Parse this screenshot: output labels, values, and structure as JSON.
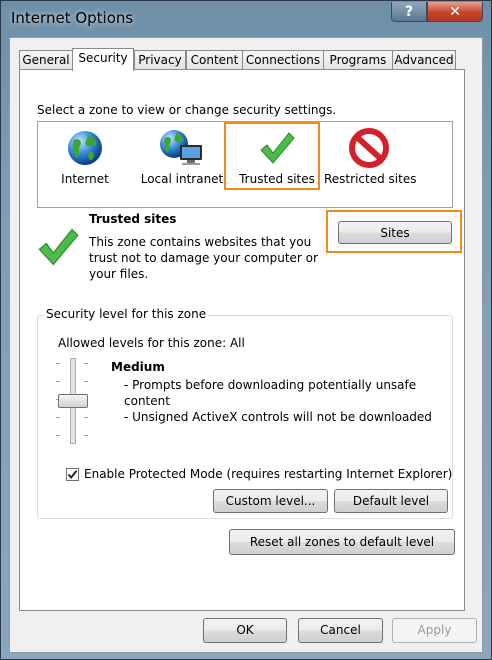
{
  "window": {
    "title": "Internet Options",
    "help_label": "?",
    "close_label": "✕"
  },
  "tabs": [
    "General",
    "Security",
    "Privacy",
    "Content",
    "Connections",
    "Programs",
    "Advanced"
  ],
  "active_tab": "Security",
  "zone_prompt": "Select a zone to view or change security settings.",
  "zones": [
    {
      "label": "Internet",
      "icon": "globe-icon"
    },
    {
      "label": "Local intranet",
      "icon": "globe-computer-icon"
    },
    {
      "label": "Trusted sites",
      "icon": "green-check-icon",
      "selected": true
    },
    {
      "label": "Restricted sites",
      "icon": "no-entry-icon"
    }
  ],
  "selected_zone": {
    "title": "Trusted sites",
    "description": "This zone contains websites that you trust not to damage your computer or your files.",
    "sites_button": "Sites"
  },
  "security_level": {
    "group_title": "Security level for this zone",
    "allowed": "Allowed levels for this zone: All",
    "level": "Medium",
    "bullets": [
      "- Prompts before downloading potentially unsafe content",
      "- Unsigned ActiveX controls will not be downloaded"
    ],
    "protected_mode_label": "Enable Protected Mode (requires restarting Internet Explorer)",
    "protected_mode_checked": true,
    "custom_level_button": "Custom level...",
    "default_level_button": "Default level"
  },
  "reset_all_button": "Reset all zones to default level",
  "footer": {
    "ok": "OK",
    "cancel": "Cancel",
    "apply": "Apply"
  },
  "colors": {
    "highlight": "#f08c1e",
    "check_green": "#3cb23c",
    "no_entry_red": "#d4202a"
  }
}
